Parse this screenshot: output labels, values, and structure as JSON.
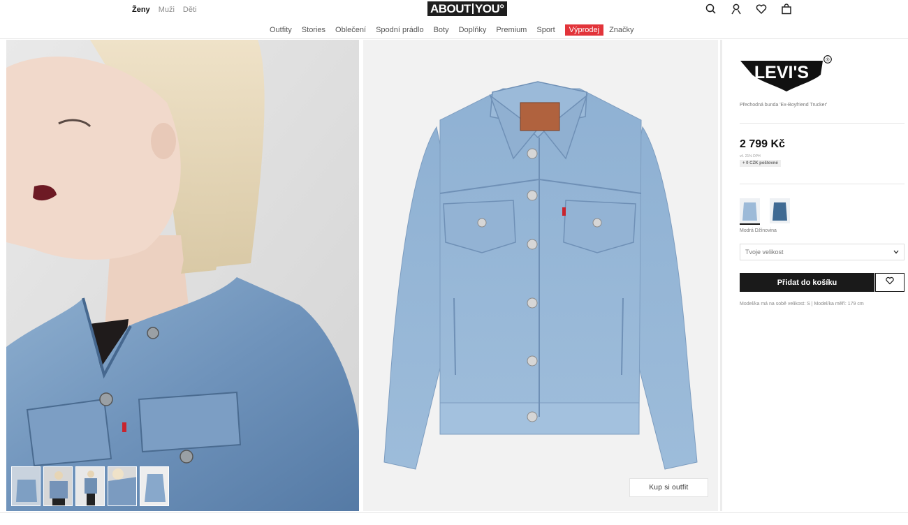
{
  "header": {
    "genders": [
      "Ženy",
      "Muži",
      "Děti"
    ],
    "logo": {
      "part1": "ABOUT",
      "part2": "YOU°"
    },
    "icons": [
      "search-icon",
      "user-icon",
      "heart-icon",
      "bag-icon"
    ]
  },
  "nav": {
    "items": [
      "Outfity",
      "Stories",
      "Oblečení",
      "Spodní prádlo",
      "Boty",
      "Doplňky",
      "Premium",
      "Sport",
      "Výprodej",
      "Značky"
    ],
    "sale_color": "#e2343a"
  },
  "gallery": {
    "outfit_button": "Kup si outfit",
    "thumbnail_count": 5
  },
  "product": {
    "brand": "LEVI'S",
    "name": "Přechodná bunda 'Ex-Boyfriend Trucker'",
    "price": "2 799 Kč",
    "vat": "vč. 21% DPH",
    "shipping": "+ 0 CZK poštovné",
    "color_name": "Modrá Džínovina",
    "size_placeholder": "Tvoje velikost",
    "add_to_cart": "Přidat do košíku",
    "model_info": "Model/ka má na sobě velikost: S | Model/ka měří: 179 cm"
  }
}
